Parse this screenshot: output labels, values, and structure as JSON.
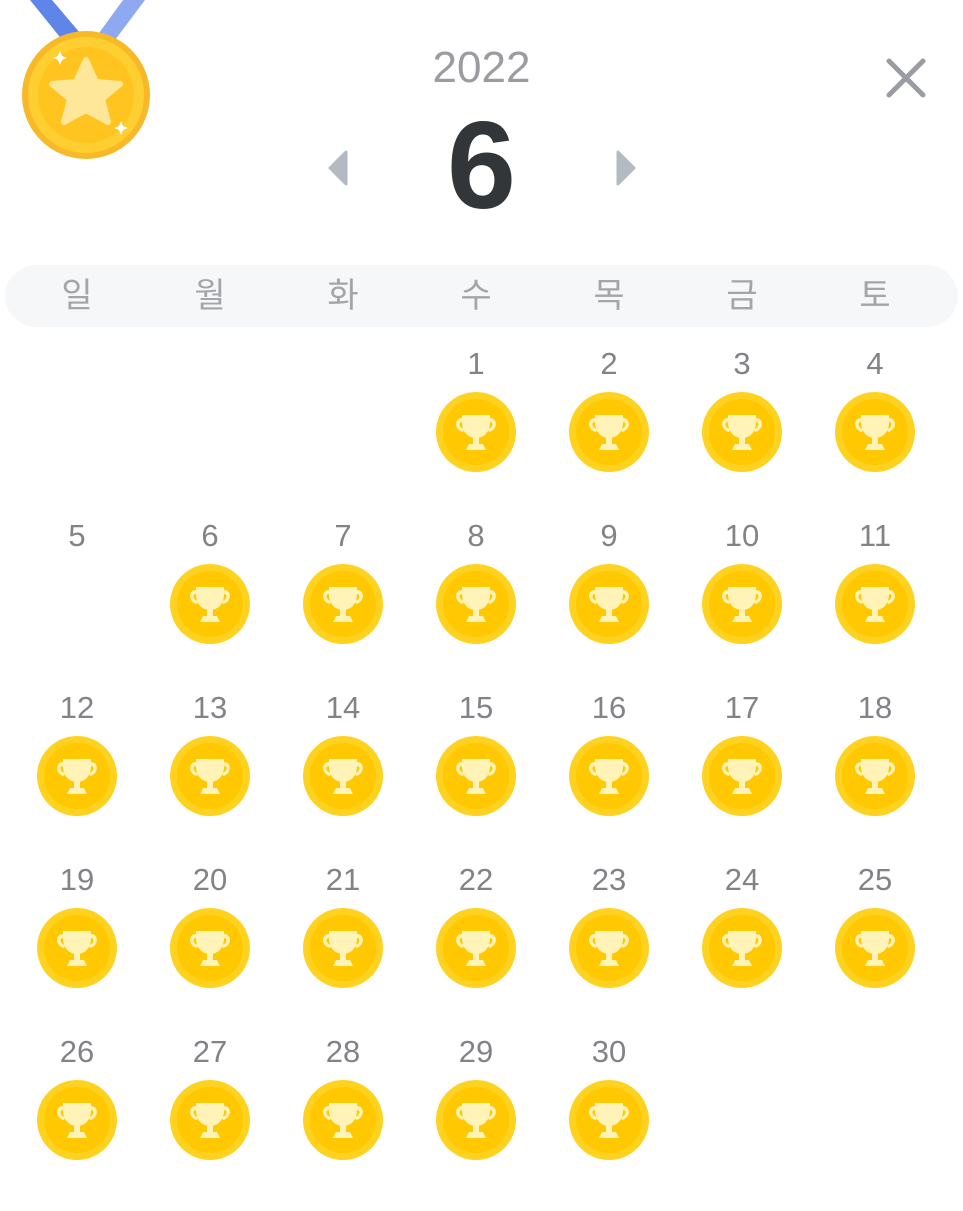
{
  "header": {
    "year": "2022",
    "month": "6"
  },
  "icons": {
    "medal": "medal-star-icon",
    "prev": "caret-left-icon",
    "next": "caret-right-icon",
    "close": "close-icon",
    "trophy": "trophy-icon"
  },
  "weekdays": [
    "일",
    "월",
    "화",
    "수",
    "목",
    "금",
    "토"
  ],
  "calendar": {
    "first_weekday_index": 3,
    "days": [
      {
        "day": "1",
        "trophy": true
      },
      {
        "day": "2",
        "trophy": true
      },
      {
        "day": "3",
        "trophy": true
      },
      {
        "day": "4",
        "trophy": true
      },
      {
        "day": "5",
        "trophy": false
      },
      {
        "day": "6",
        "trophy": true
      },
      {
        "day": "7",
        "trophy": true
      },
      {
        "day": "8",
        "trophy": true
      },
      {
        "day": "9",
        "trophy": true
      },
      {
        "day": "10",
        "trophy": true
      },
      {
        "day": "11",
        "trophy": true
      },
      {
        "day": "12",
        "trophy": true
      },
      {
        "day": "13",
        "trophy": true
      },
      {
        "day": "14",
        "trophy": true
      },
      {
        "day": "15",
        "trophy": true
      },
      {
        "day": "16",
        "trophy": true
      },
      {
        "day": "17",
        "trophy": true
      },
      {
        "day": "18",
        "trophy": true
      },
      {
        "day": "19",
        "trophy": true
      },
      {
        "day": "20",
        "trophy": true
      },
      {
        "day": "21",
        "trophy": true
      },
      {
        "day": "22",
        "trophy": true
      },
      {
        "day": "23",
        "trophy": true
      },
      {
        "day": "24",
        "trophy": true
      },
      {
        "day": "25",
        "trophy": true
      },
      {
        "day": "26",
        "trophy": true
      },
      {
        "day": "27",
        "trophy": true
      },
      {
        "day": "28",
        "trophy": true
      },
      {
        "day": "29",
        "trophy": true
      },
      {
        "day": "30",
        "trophy": true
      }
    ]
  },
  "colors": {
    "coin_outer": "#FFD21F",
    "coin_inner": "#FFC800",
    "trophy": "#FFF3B8",
    "medal_ribbon": "#7B9BEF",
    "medal_gold": "#FFCC33",
    "medal_star": "#FFE89A",
    "nav_arrow": "#B4BAC2",
    "weekday_bar": "#F6F7F8"
  }
}
